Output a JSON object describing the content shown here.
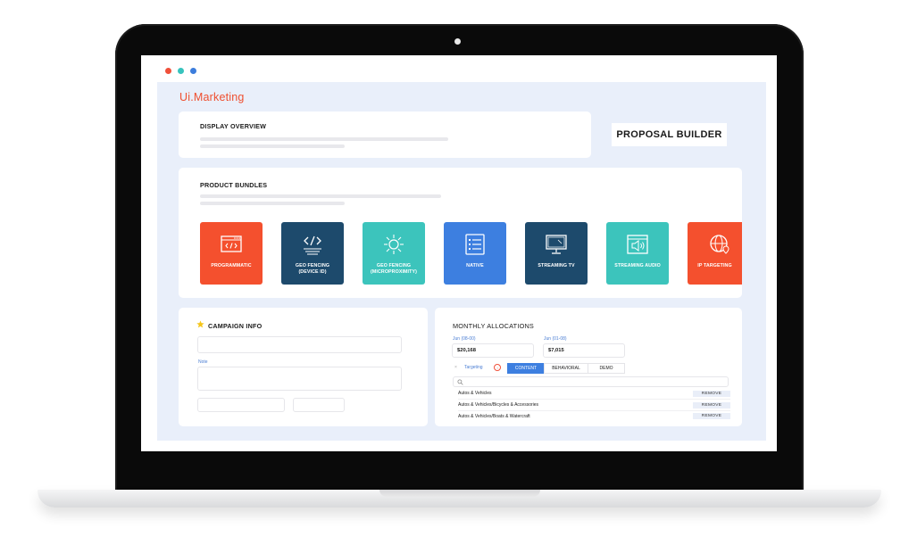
{
  "window": {
    "controls": [
      "close",
      "minimize",
      "maximize"
    ],
    "colors": {
      "close": "#f0503a",
      "minimize": "#37c3bd",
      "maximize": "#3c7ddc"
    }
  },
  "app": {
    "brand": "Ui.Marketing",
    "brand_color": "#ef4f2f",
    "background": "#e9effa"
  },
  "display_overview": {
    "title": "DISPLAY OVERVIEW"
  },
  "proposal_builder": {
    "label": "PROPOSAL BUILDER"
  },
  "product_bundles": {
    "title": "PRODUCT BUNDLES",
    "items": [
      {
        "label": "PROGRAMMATIC",
        "color": "#f4502e",
        "icon": "code-window-icon"
      },
      {
        "label": "GEO FENCING\n(DEVICE ID)",
        "color": "#1d4a6c",
        "icon": "code-brackets-icon"
      },
      {
        "label": "GEO FENCING\n(MICROPROXIMITY)",
        "color": "#3cc4bc",
        "icon": "sun-burst-icon"
      },
      {
        "label": "NATIVE",
        "color": "#3d7fe0",
        "icon": "list-document-icon"
      },
      {
        "label": "STREAMING TV",
        "color": "#1d4a6c",
        "icon": "tv-icon"
      },
      {
        "label": "STREAMING AUDIO",
        "color": "#3cc4bc",
        "icon": "speaker-window-icon"
      },
      {
        "label": "IP TARGETING",
        "color": "#f4502e",
        "icon": "globe-pin-icon"
      }
    ]
  },
  "campaign_info": {
    "title": "CAMPAIGN INFO",
    "icon": "star-icon",
    "note_label": "Note"
  },
  "monthly_allocations": {
    "title": "MONTHLY ALLOCATIONS",
    "months": [
      {
        "label": "Jun (08-00)",
        "value": "$20,168"
      },
      {
        "label": "Jun (01-08)",
        "value": "$7,015"
      }
    ],
    "targeting_label": "Targeting",
    "tabs": [
      {
        "label": "CONTENT",
        "active": true
      },
      {
        "label": "BEHAVIORAL",
        "active": false
      },
      {
        "label": "DEMO",
        "active": false
      }
    ],
    "search_icon": "search-icon",
    "rows": [
      {
        "label": "Autos & Vehicles",
        "action": "REMOVE"
      },
      {
        "label": "Autos & Vehicles/Bicycles & Accessories",
        "action": "REMOVE"
      },
      {
        "label": "Autos & Vehicles/Boats & Watercraft",
        "action": "REMOVE"
      }
    ]
  }
}
